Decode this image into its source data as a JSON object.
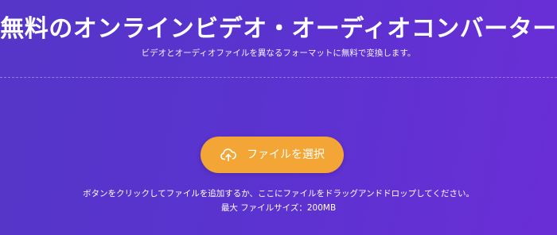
{
  "header": {
    "title": "無料のオンラインビデオ・オーディオコンバーター",
    "subtitle": "ビデオとオーディオファイルを異なるフォーマットに無料で変換します。"
  },
  "upload": {
    "button_label": "ファイルを選択",
    "button_icon": "cloud-upload-icon",
    "hint": "ボタンをクリックしてファイルを追加するか、ここにファイルをドラッグアンドドロップしてください。",
    "max_size": "最大 ファイルサイズ：200MB"
  },
  "colors": {
    "accent": "#f3a535",
    "background_start": "#5536c8",
    "background_end": "#6a2ed6"
  }
}
